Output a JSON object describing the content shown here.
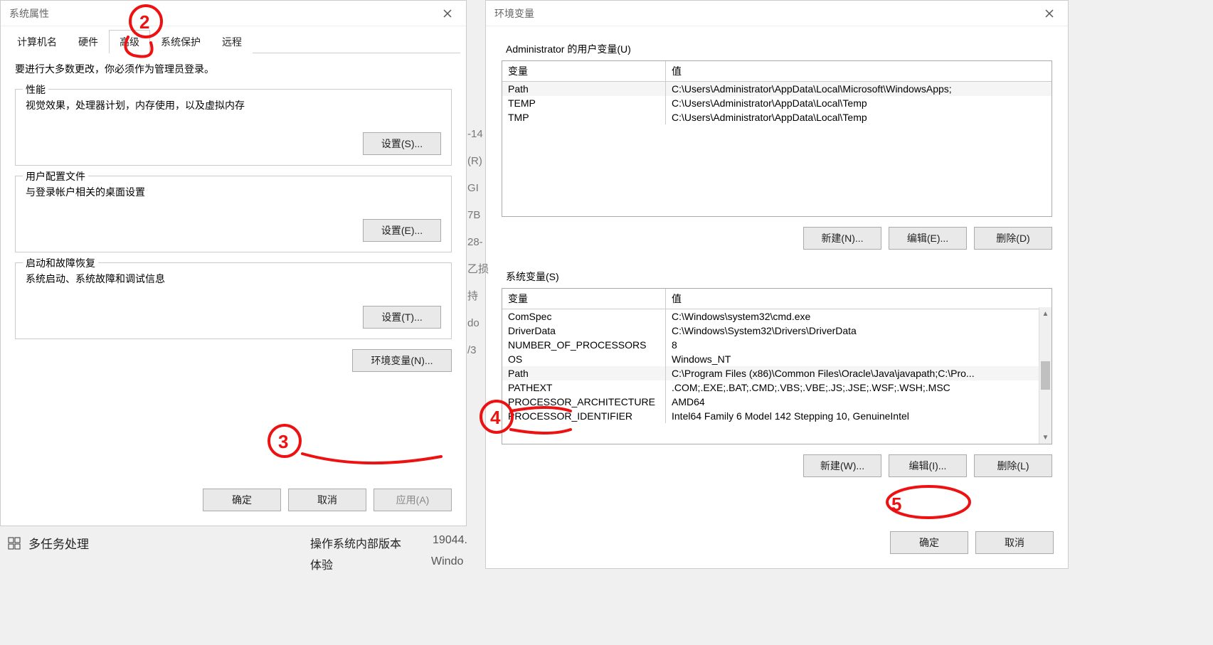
{
  "left_dialog": {
    "title": "系统属性",
    "tabs": [
      "计算机名",
      "硬件",
      "高级",
      "系统保护",
      "远程"
    ],
    "active_tab_label": "高级",
    "intro": "要进行大多数更改，你必须作为管理员登录。",
    "groups": {
      "perf": {
        "legend": "性能",
        "desc": "视觉效果，处理器计划，内存使用，以及虚拟内存",
        "btn": "设置(S)..."
      },
      "profile": {
        "legend": "用户配置文件",
        "desc": "与登录帐户相关的桌面设置",
        "btn": "设置(E)..."
      },
      "startup": {
        "legend": "启动和故障恢复",
        "desc": "系统启动、系统故障和调试信息",
        "btn": "设置(T)..."
      }
    },
    "env_btn": "环境变量(N)...",
    "footer": {
      "ok": "确定",
      "cancel": "取消",
      "apply": "应用(A)"
    }
  },
  "right_dialog": {
    "title": "环境变量",
    "user_section_title": "Administrator 的用户变量(U)",
    "col_var": "变量",
    "col_val": "值",
    "user_vars": [
      {
        "name": "Path",
        "value": "C:\\Users\\Administrator\\AppData\\Local\\Microsoft\\WindowsApps;"
      },
      {
        "name": "TEMP",
        "value": "C:\\Users\\Administrator\\AppData\\Local\\Temp"
      },
      {
        "name": "TMP",
        "value": "C:\\Users\\Administrator\\AppData\\Local\\Temp"
      }
    ],
    "user_btns": {
      "new": "新建(N)...",
      "edit": "编辑(E)...",
      "del": "删除(D)"
    },
    "sys_section_title": "系统变量(S)",
    "sys_vars": [
      {
        "name": "ComSpec",
        "value": "C:\\Windows\\system32\\cmd.exe"
      },
      {
        "name": "DriverData",
        "value": "C:\\Windows\\System32\\Drivers\\DriverData"
      },
      {
        "name": "NUMBER_OF_PROCESSORS",
        "value": "8"
      },
      {
        "name": "OS",
        "value": "Windows_NT"
      },
      {
        "name": "Path",
        "value": "C:\\Program Files (x86)\\Common Files\\Oracle\\Java\\javapath;C:\\Pro..."
      },
      {
        "name": "PATHEXT",
        "value": ".COM;.EXE;.BAT;.CMD;.VBS;.VBE;.JS;.JSE;.WSF;.WSH;.MSC"
      },
      {
        "name": "PROCESSOR_ARCHITECTURE",
        "value": "AMD64"
      },
      {
        "name": "PROCESSOR_IDENTIFIER",
        "value": "Intel64 Family 6 Model 142 Stepping 10, GenuineIntel"
      }
    ],
    "sys_btns": {
      "new": "新建(W)...",
      "edit": "编辑(I)...",
      "del": "删除(L)"
    },
    "footer": {
      "ok": "确定",
      "cancel": "取消"
    }
  },
  "background": {
    "sidebar_item": "多任务处理",
    "os_label": "操作系统内部版本",
    "os_value": "19044.",
    "exp_label": "体验",
    "exp_value": "Windo",
    "peek": [
      "-14",
      "(R)",
      "",
      "GI",
      "7B",
      "",
      "28-",
      "乙损",
      "持",
      "",
      "",
      "",
      "",
      "do",
      "/3"
    ]
  }
}
